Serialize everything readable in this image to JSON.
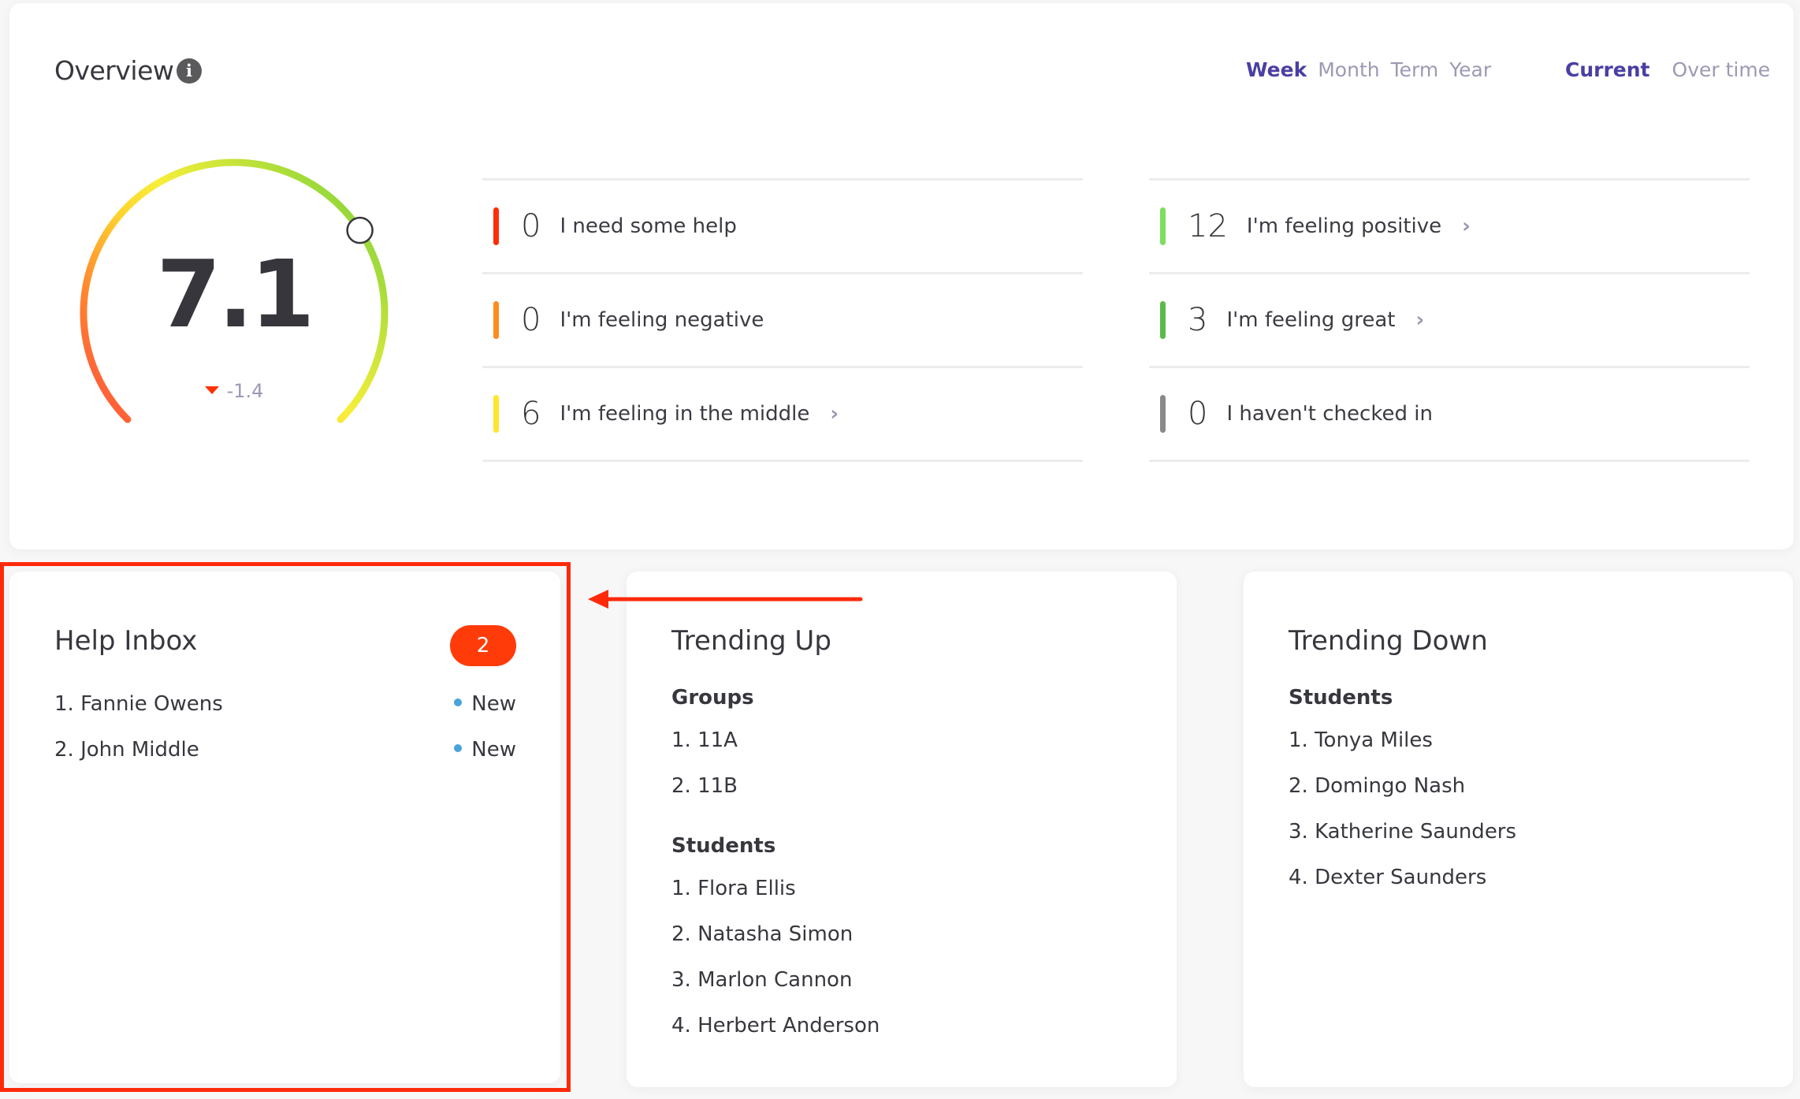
{
  "overview": {
    "title": "Overview",
    "info_icon": "info-icon",
    "period_tabs": [
      {
        "label": "Week",
        "active": true
      },
      {
        "label": "Month",
        "active": false
      },
      {
        "label": "Term",
        "active": false
      },
      {
        "label": "Year",
        "active": false
      }
    ],
    "view_tabs": [
      {
        "label": "Current",
        "active": true
      },
      {
        "label": "Over time",
        "active": false
      }
    ],
    "gauge": {
      "score": "7.1",
      "score_value": 7.1,
      "scale_max": 10,
      "delta": "-1.4",
      "delta_direction": "down",
      "colors": [
        "#ff4a3d",
        "#ff7a2e",
        "#ffc629",
        "#f8ee3a",
        "#c8e43a",
        "#8fd63a"
      ]
    },
    "moods_left": [
      {
        "count": "0",
        "label": "I need some help",
        "color": "#ff2d0a",
        "has_link": false
      },
      {
        "count": "0",
        "label": "I'm feeling negative",
        "color": "#ff8a1e",
        "has_link": false
      },
      {
        "count": "6",
        "label": "I'm feeling in the middle",
        "color": "#ffe52e",
        "has_link": true
      }
    ],
    "moods_right": [
      {
        "count": "12",
        "label": "I'm feeling positive",
        "color": "#7ddd5f",
        "has_link": true
      },
      {
        "count": "3",
        "label": "I'm feeling great",
        "color": "#5cba48",
        "has_link": true
      },
      {
        "count": "0",
        "label": "I haven't checked in",
        "color": "#8a8a8a",
        "has_link": false
      }
    ],
    "chevron": "›"
  },
  "help_inbox": {
    "title": "Help Inbox",
    "badge_count": "2",
    "items": [
      {
        "name": "1. Fannie Owens",
        "status": "New"
      },
      {
        "name": "2. John Middle",
        "status": "New"
      }
    ]
  },
  "trending_up": {
    "title": "Trending Up",
    "groups_heading": "Groups",
    "groups": [
      "1. 11A",
      "2. 11B"
    ],
    "students_heading": "Students",
    "students": [
      "1. Flora Ellis",
      "2. Natasha Simon",
      "3. Marlon Cannon",
      "4. Herbert Anderson"
    ]
  },
  "trending_down": {
    "title": "Trending Down",
    "students_heading": "Students",
    "students": [
      "1. Tonya Miles",
      "2. Domingo Nash",
      "3. Katherine Saunders",
      "4. Dexter Saunders"
    ]
  },
  "annotation": {
    "highlight_color": "#ff2a0a",
    "target": "help-inbox-card"
  }
}
